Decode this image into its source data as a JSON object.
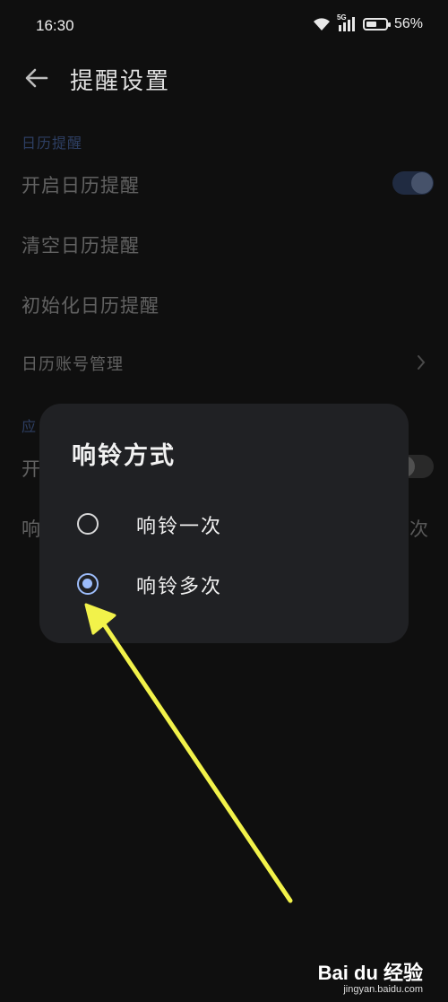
{
  "status_bar": {
    "time": "16:30",
    "network": "5G",
    "battery_text": "56%",
    "battery_level": 0.56
  },
  "header": {
    "title": "提醒设置"
  },
  "background_list": {
    "section_calendar": "日历提醒",
    "item_enable_calendar": "开启日历提醒",
    "item_clear_calendar": "清空日历提醒",
    "item_init_calendar": "初始化日历提醒",
    "item_account_mgmt": "日历账号管理",
    "section_app_partial": "应",
    "item_enable_app_partial": "开",
    "item_ring_partial": "响",
    "item_ring_value_partial": "次"
  },
  "dialog": {
    "title": "响铃方式",
    "options": [
      {
        "label": "响铃一次",
        "selected": false
      },
      {
        "label": "响铃多次",
        "selected": true
      }
    ]
  },
  "watermark": {
    "brand": "Bai du 经验",
    "url": "jingyan.baidu.com"
  },
  "colors": {
    "accent": "#9cbcfa",
    "section": "#5f8ce8",
    "arrow": "#f2f24a",
    "background": "#0f0f0f",
    "dialog": "#202124"
  }
}
